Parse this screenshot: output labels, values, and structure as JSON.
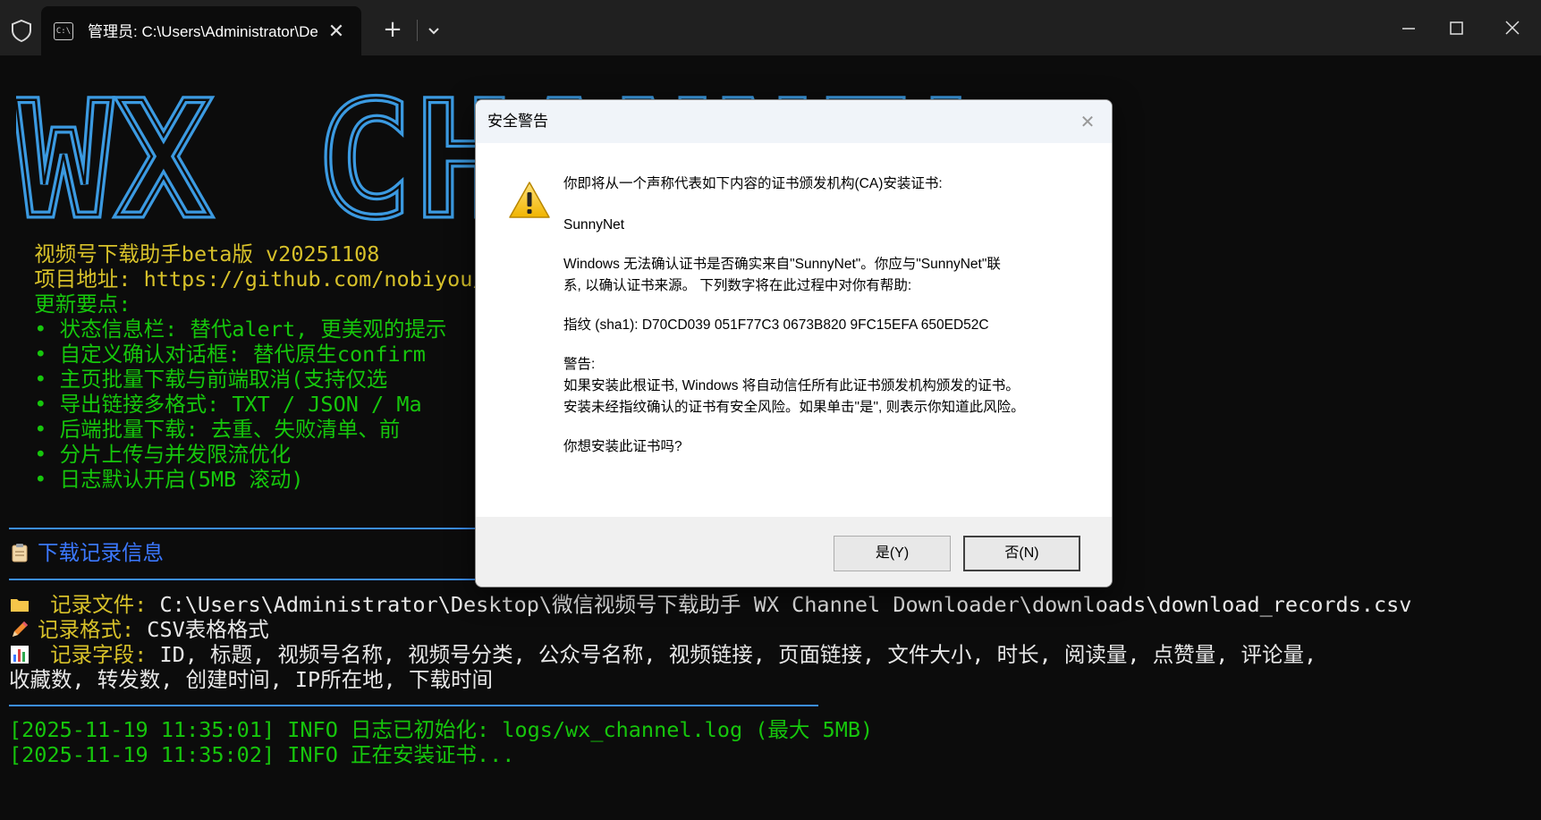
{
  "window": {
    "tab_title": "管理员: C:\\Users\\Administrator\\Desktop\\微信视频号下载助手",
    "tab_icon_text": "C:\\",
    "new_tab_label": "+"
  },
  "banner_text": "WX CHANNEL",
  "console": {
    "app_line": "  视频号下载助手beta版 v20251108",
    "project_line": "  项目地址: https://github.com/nobiyou/wx_channel",
    "update_heading": "  更新要点:",
    "updates": [
      "  • 状态信息栏: 替代alert, 更美观的提示",
      "  • 自定义确认对话框: 替代原生confirm",
      "  • 主页批量下载与前端取消(支持仅选",
      "  • 导出链接多格式: TXT / JSON / Ma",
      "  • 后端批量下载: 去重、失败清单、前",
      "  • 分片上传与并发限流优化",
      "  • 日志默认开启(5MB 滚动)"
    ],
    "records_heading": "下载记录信息",
    "file_label": " 记录文件: ",
    "file_value": "C:\\Users\\Administrator\\Desktop\\微信视频号下载助手 WX Channel Downloader\\downloads\\download_records.csv",
    "format_label": "记录格式: ",
    "format_value": "CSV表格格式",
    "fields_label": " 记录字段: ",
    "fields_value_1": "ID, 标题, 视频号名称, 视频号分类, 公众号名称, 视频链接, 页面链接, 文件大小, 时长, 阅读量, 点赞量, 评论量,",
    "fields_value_2": "收藏数, 转发数, 创建时间, IP所在地, 下载时间",
    "log_1": "[2025-11-19 11:35:01] INFO 日志已初始化: logs/wx_channel.log (最大 5MB)",
    "log_2": "[2025-11-19 11:35:02] INFO 正在安装证书..."
  },
  "dialog": {
    "title": "安全警告",
    "close": "✕",
    "intro": "你即将从一个声称代表如下内容的证书颁发机构(CA)安装证书:",
    "issuer": "SunnyNet",
    "verify_1": "Windows 无法确认证书是否确实来自\"SunnyNet\"。你应与\"SunnyNet\"联",
    "verify_2": "系, 以确认证书来源。 下列数字将在此过程中对你有帮助:",
    "fingerprint": "指纹 (sha1): D70CD039 051F77C3 0673B820 9FC15EFA 650ED52C",
    "warning_label": "警告:",
    "warning_1": "如果安装此根证书, Windows 将自动信任所有此证书颁发机构颁发的证书。",
    "warning_2": "安装未经指纹确认的证书有安全风险。如果单击\"是\", 则表示你知道此风险。",
    "question": "你想安装此证书吗?",
    "yes_button": "是(Y)",
    "no_button": "否(N)"
  },
  "colors": {
    "console_bg": "#0c0c0c",
    "banner_blue": "#3b9ae1",
    "yellow": "#d7c12a",
    "green": "#16c60c",
    "heading_blue": "#3b78ff"
  }
}
